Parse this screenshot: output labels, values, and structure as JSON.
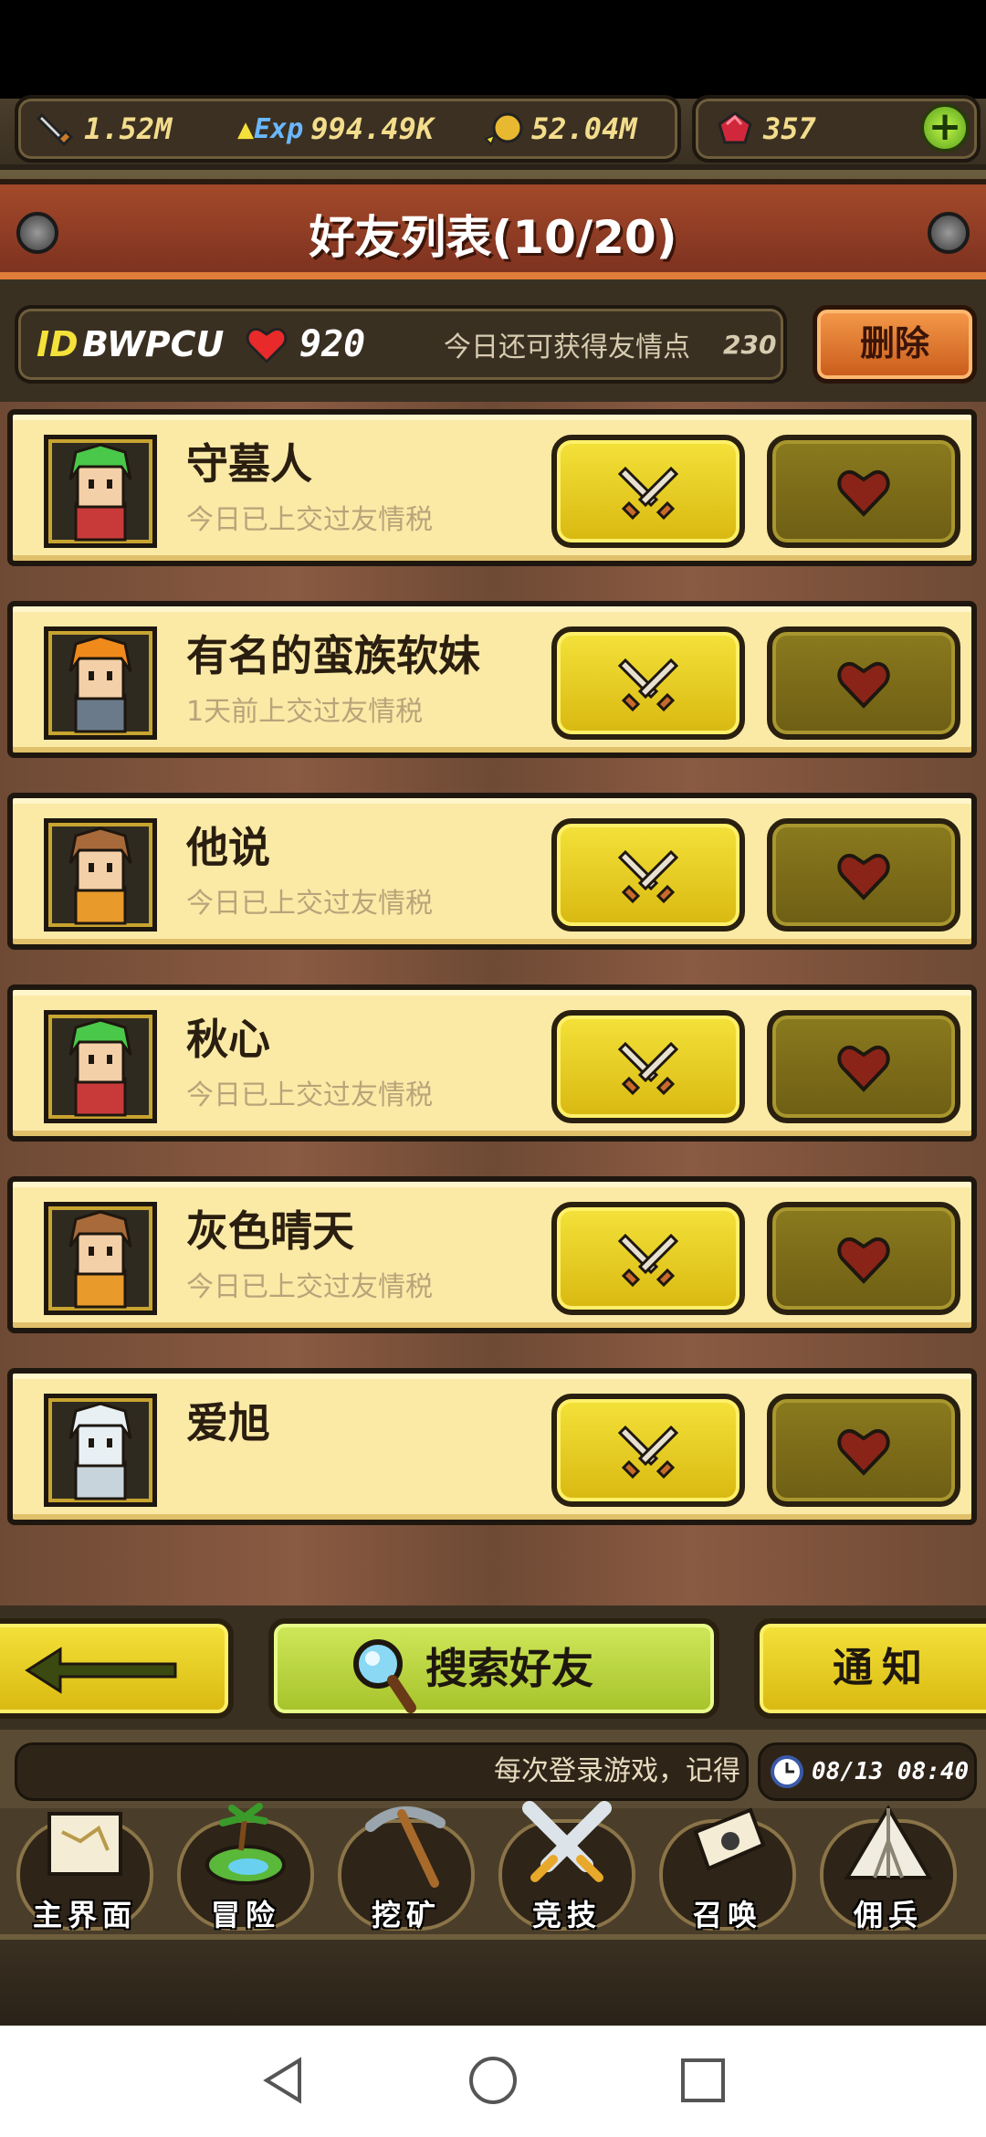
{
  "resources": {
    "attack": "1.52M",
    "exp": "994.49K",
    "gold": "52.04M",
    "gems": "357",
    "exp_icon_label": "Exp",
    "plus_label": "+"
  },
  "title": "好友列表(10/20)",
  "info": {
    "id_prefix": "ID",
    "id_value": "BWPCU",
    "hearts": "920",
    "remaining_text": "今日还可获得友情点",
    "remaining_value": "230",
    "delete_label": "删除"
  },
  "friends": [
    {
      "name": "守墓人",
      "status": "今日已上交过友情税",
      "avatar": "green-hair-hero"
    },
    {
      "name": "有名的蛮族软妹",
      "status": "1天前上交过友情税",
      "avatar": "orange-hair-knight"
    },
    {
      "name": "他说",
      "status": "今日已上交过友情税",
      "avatar": "brown-hair-hero"
    },
    {
      "name": "秋心",
      "status": "今日已上交过友情税",
      "avatar": "green-hair-hero"
    },
    {
      "name": "灰色晴天",
      "status": "今日已上交过友情税",
      "avatar": "brown-hair-hero"
    },
    {
      "name": "爱旭",
      "status": "",
      "avatar": "polar-bear"
    }
  ],
  "actions": {
    "search_label": "搜索好友",
    "notice_label": "通知"
  },
  "ticker": {
    "text": "每次登录游戏，记得",
    "clock": "08/13 08:40"
  },
  "nav": [
    {
      "label": "主界面",
      "icon": "scroll-map-icon"
    },
    {
      "label": "冒险",
      "icon": "island-icon"
    },
    {
      "label": "挖矿",
      "icon": "pickaxe-icon"
    },
    {
      "label": "竞技",
      "icon": "crossed-swords-icon"
    },
    {
      "label": "召唤",
      "icon": "summon-scroll-icon"
    },
    {
      "label": "佣兵",
      "icon": "tent-icon"
    }
  ],
  "colors": {
    "accent_yellow": "#f4e23a",
    "banner_red": "#a44a2a",
    "gold_text": "#f3dd8c",
    "row_bg": "#fbeaa6"
  }
}
